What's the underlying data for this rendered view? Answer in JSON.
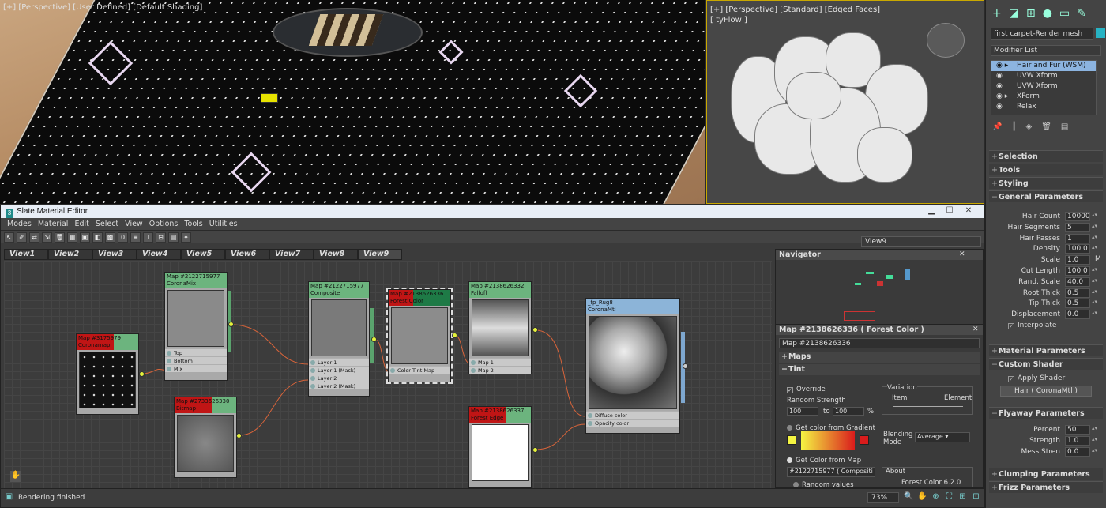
{
  "viewport_top": {
    "label": "[+] [Perspective] [User Defined] [Default Shading]"
  },
  "viewport_right": {
    "label_line1": "[+] [Perspective] [Standard] [Edged Faces]",
    "label_line2": "[ tyFlow ]"
  },
  "command_panel": {
    "object_name": "first carpet-Render mesh",
    "object_color": "#27b3c4",
    "modifier_list_label": "Modifier List",
    "stack": [
      {
        "label": "Hair and Fur (WSM)",
        "selected": true
      },
      {
        "label": "UVW Xform",
        "selected": false
      },
      {
        "label": "UVW Xform",
        "selected": false
      },
      {
        "label": "XForm",
        "selected": false
      },
      {
        "label": "Relax",
        "selected": false
      }
    ],
    "rollouts": {
      "selection": "Selection",
      "tools": "Tools",
      "styling": "Styling",
      "general": "General Parameters",
      "material": "Material Parameters",
      "custom_shader": "Custom Shader",
      "flyaway": "Flyaway Parameters",
      "clumping": "Clumping Parameters",
      "frizz": "Frizz Parameters"
    },
    "general_params": [
      {
        "label": "Hair Count",
        "value": "10000"
      },
      {
        "label": "Hair Segments",
        "value": "5"
      },
      {
        "label": "Hair Passes",
        "value": "1"
      },
      {
        "label": "Density",
        "value": "100.0"
      },
      {
        "label": "Scale",
        "value": "1.0"
      },
      {
        "label": "Cut Length",
        "value": "100.0"
      },
      {
        "label": "Rand. Scale",
        "value": "40.0"
      },
      {
        "label": "Root Thick",
        "value": "0.5"
      },
      {
        "label": "Tip Thick",
        "value": "0.5"
      },
      {
        "label": "Displacement",
        "value": "0.0"
      }
    ],
    "interpolate_label": "Interpolate",
    "apply_shader_label": "Apply Shader",
    "shader_button": "Hair ( CoronaMtl )",
    "flyaway_params": [
      {
        "label": "Percent",
        "value": "50"
      },
      {
        "label": "Strength",
        "value": "1.0"
      },
      {
        "label": "Mess Stren",
        "value": "0.0"
      }
    ],
    "m_label": "M"
  },
  "editor": {
    "title": "Slate Material Editor",
    "menu": [
      "Modes",
      "Material",
      "Edit",
      "Select",
      "View",
      "Options",
      "Tools",
      "Utilities"
    ],
    "view_select": "View9",
    "tabs": [
      "View1",
      "View2",
      "View3",
      "View4",
      "View5",
      "View6",
      "View7",
      "View8",
      "View9"
    ],
    "active_tab": "View9",
    "nodes": {
      "bitmap": {
        "id": "Map #3175979",
        "type": "Coronamap"
      },
      "coronamix": {
        "id": "Map #2122715977",
        "type": "CoronaMix",
        "slots": [
          "Top",
          "Bottom",
          "Mix"
        ]
      },
      "map2": {
        "id": "Map #2733626330",
        "type": "Bitmap"
      },
      "composite": {
        "id": "Map #2122715977",
        "type": "Composite",
        "slots": [
          "Layer 1",
          "Layer 1 (Mask)",
          "Layer 2",
          "Layer 2 (Mask)"
        ]
      },
      "forestcolor": {
        "id": "Map #2138626336",
        "type": "Forest Color",
        "slots": [
          "Color Tint Map"
        ]
      },
      "falloff": {
        "id": "Map #2138626332",
        "type": "Falloff",
        "slots": [
          "Map 1",
          "Map 2"
        ]
      },
      "forestedge": {
        "id": "Map #2138626337",
        "type": "Forest Edge"
      },
      "coronamtl": {
        "id": "_fp_Rug8",
        "type": "CoronaMtl",
        "slots": [
          "Diffuse color",
          "Opacity color"
        ]
      }
    },
    "navigator_title": "Navigator",
    "props_title": "Map #2138626336  ( Forest Color )",
    "props_name": "Map #2138626336",
    "sec_maps": "Maps",
    "sec_tint": "Tint",
    "override_label": "Override",
    "random_strength_label": "Random Strength",
    "rs_from": "100",
    "rs_to_label": "to",
    "rs_to": "100",
    "rs_pct": "%",
    "variation_label": "Variation",
    "item_label": "Item",
    "element_label": "Element",
    "gradient_label": "Get color from Gradient",
    "blending_label": "Blending Mode",
    "blending_value": "Average",
    "map_label": "Get Color from Map",
    "map_value": "#2122715977  ( Compositi",
    "random_values_label": "Random values",
    "about_label": "About",
    "about_version": "Forest Color 6.2.0",
    "status": "Rendering finished",
    "zoom": "73%"
  },
  "colors": {
    "gradient_start": "#f5f542",
    "gradient_end": "#d91c1c"
  }
}
